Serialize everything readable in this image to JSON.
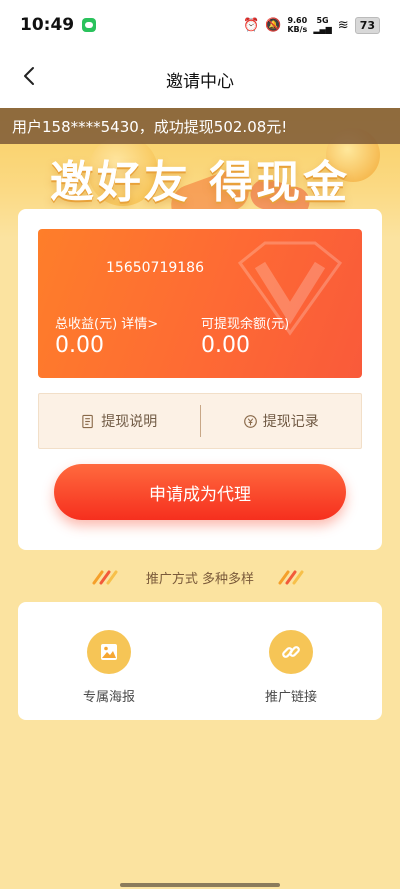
{
  "status_bar": {
    "time": "10:49",
    "net_speed_value": "9.60",
    "net_speed_unit": "KB/s",
    "network": "5G",
    "battery": "73"
  },
  "nav": {
    "title": "邀请中心"
  },
  "ticker": {
    "text": "用户158****5430，成功提现502.08元!"
  },
  "hero": {
    "title": "邀好友 得现金"
  },
  "earnings_card": {
    "phone": "15650719186",
    "total_label": "总收益(元) 详情>",
    "total_value": "0.00",
    "withdrawable_label": "可提现余额(元)",
    "withdrawable_value": "0.00"
  },
  "actions": {
    "withdraw_info": "提现说明",
    "withdraw_record": "提现记录"
  },
  "agent_button": {
    "label": "申请成为代理"
  },
  "promo": {
    "caption": "推广方式 多种多样",
    "poster_label": "专属海报",
    "link_label": "推广链接"
  },
  "colors": {
    "page_bg": "#fbe3a0",
    "card_orange": "#fe6a34",
    "button_red": "#f62f1e",
    "icon_gold": "#f6c556"
  }
}
